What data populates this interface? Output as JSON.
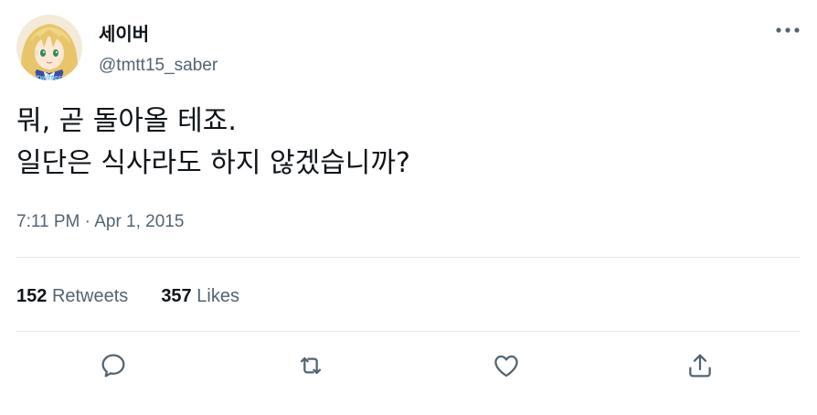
{
  "author": {
    "display_name": "세이버",
    "handle": "@tmtt15_saber",
    "avatar_watermark": "twitter"
  },
  "tweet": {
    "lines": [
      "뭐, 곧 돌아올 테죠.",
      "일단은 식사라도 하지 않겠습니까?"
    ],
    "time": "7:11 PM",
    "separator": "·",
    "date": "Apr 1, 2015"
  },
  "stats": {
    "retweets_count": "152",
    "retweets_label": "Retweets",
    "likes_count": "357",
    "likes_label": "Likes"
  },
  "icons": {
    "more": "more-horizontal-icon",
    "reply": "reply-icon",
    "retweet": "retweet-icon",
    "like": "heart-icon",
    "share": "share-icon"
  },
  "colors": {
    "text": "#0f1419",
    "secondary": "#536471",
    "divider": "#e5e8eb"
  }
}
